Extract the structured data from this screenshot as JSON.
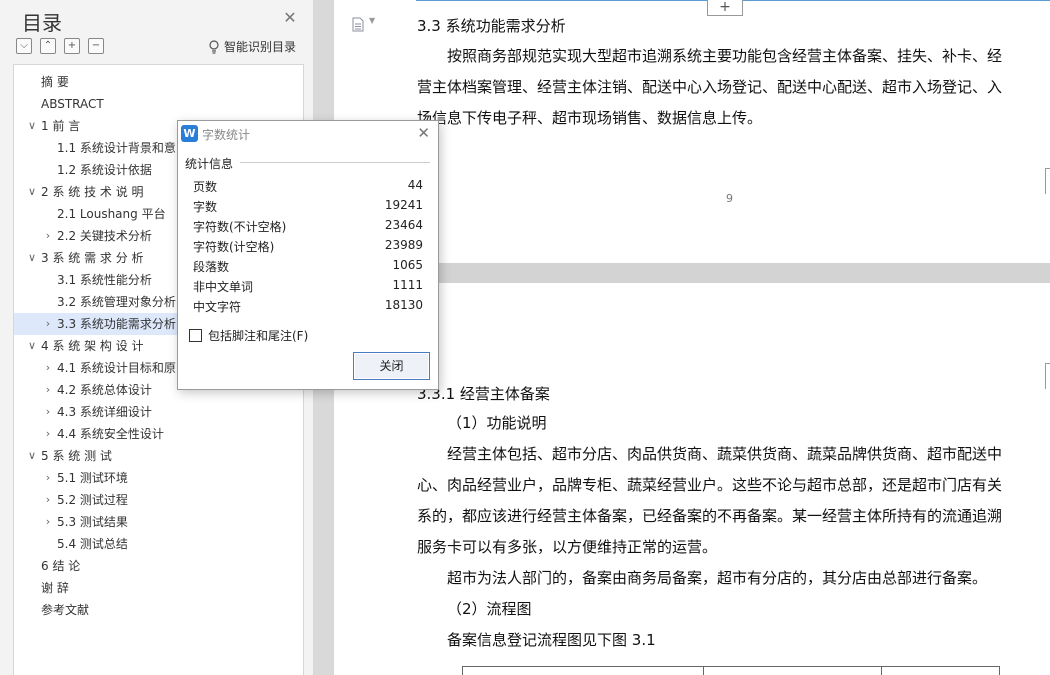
{
  "sidebar": {
    "title": "目录",
    "smart_toc_label": "智能识别目录",
    "tools": [
      "⌵",
      "⌃",
      "+",
      "−"
    ],
    "items": [
      {
        "label": "摘 要",
        "level": 1,
        "expandable": false
      },
      {
        "label": "ABSTRACT",
        "level": 1,
        "expandable": false
      },
      {
        "label": "1 前 言",
        "level": 1,
        "expandable": true
      },
      {
        "label": "1.1 系统设计背景和意",
        "level": 2,
        "expandable": false
      },
      {
        "label": "1.2 系统设计依据",
        "level": 2,
        "expandable": false
      },
      {
        "label": "2 系 统 技 术 说 明",
        "level": 1,
        "expandable": true
      },
      {
        "label": "2.1 Loushang 平台",
        "level": 2,
        "expandable": false
      },
      {
        "label": "2.2 关键技术分析",
        "level": 2,
        "expandable": true
      },
      {
        "label": "3 系 统 需 求 分 析",
        "level": 1,
        "expandable": true
      },
      {
        "label": "3.1 系统性能分析",
        "level": 2,
        "expandable": false
      },
      {
        "label": "3.2 系统管理对象分析",
        "level": 2,
        "expandable": false
      },
      {
        "label": "3.3 系统功能需求分析",
        "level": 2,
        "expandable": true,
        "active": true
      },
      {
        "label": "4 系 统 架 构 设 计",
        "level": 1,
        "expandable": true
      },
      {
        "label": "4.1 系统设计目标和原",
        "level": 2,
        "expandable": true
      },
      {
        "label": "4.2 系统总体设计",
        "level": 2,
        "expandable": true
      },
      {
        "label": "4.3 系统详细设计",
        "level": 2,
        "expandable": true
      },
      {
        "label": "4.4 系统安全性设计",
        "level": 2,
        "expandable": true
      },
      {
        "label": "5 系 统 测 试",
        "level": 1,
        "expandable": true
      },
      {
        "label": "5.1 测试环境",
        "level": 2,
        "expandable": true
      },
      {
        "label": "5.2 测试过程",
        "level": 2,
        "expandable": true
      },
      {
        "label": "5.3 测试结果",
        "level": 2,
        "expandable": true
      },
      {
        "label": "5.4 测试总结",
        "level": 2,
        "expandable": false
      },
      {
        "label": "6 结 论",
        "level": 1,
        "expandable": false
      },
      {
        "label": "谢 辞",
        "level": 1,
        "expandable": false
      },
      {
        "label": "参考文献",
        "level": 1,
        "expandable": false
      }
    ]
  },
  "dialog": {
    "logo": "W",
    "title": "字数统计",
    "section_label": "统计信息",
    "stats": [
      {
        "label": "页数",
        "value": "44"
      },
      {
        "label": "字数",
        "value": "19241"
      },
      {
        "label": "字符数(不计空格)",
        "value": "23464"
      },
      {
        "label": "字符数(计空格)",
        "value": "23989"
      },
      {
        "label": "段落数",
        "value": "1065"
      },
      {
        "label": "非中文单词",
        "value": "1111"
      },
      {
        "label": "中文字符",
        "value": "18130"
      }
    ],
    "checkbox_label": "包括脚注和尾注(F)",
    "checkbox_checked": false,
    "close_button": "关闭"
  },
  "document": {
    "page1": {
      "heading": "3.3  系统功能需求分析",
      "paragraph_lines": [
        "按照商务部规范实现大型超市追溯系统主要功能包含经营主体备案、挂失、补卡、经",
        "营主体档案管理、经营主体注销、配送中心入场登记、配送中心配送、超市入场登记、入",
        "场信息下传电子秤、超市现场销售、数据信息上传。"
      ],
      "page_number": "9"
    },
    "page2": {
      "heading": "3.3.1  经营主体备案",
      "lines": [
        {
          "text": "（1）功能说明",
          "indent": true
        },
        {
          "text": "经营主体包括、超市分店、肉品供货商、蔬菜供货商、蔬菜品牌供货商、超市配送中",
          "indent": true
        },
        {
          "text": "心、肉品经营业户，品牌专柜、蔬菜经营业户。这些不论与超市总部，还是超市门店有关",
          "indent": false
        },
        {
          "text": "系的，都应该进行经营主体备案，已经备案的不再备案。某一经营主体所持有的流通追溯",
          "indent": false
        },
        {
          "text": "服务卡可以有多张，以方便维持正常的运营。",
          "indent": false
        },
        {
          "text": "超市为法人部门的，备案由商务局备案，超市有分店的，其分店由总部进行备案。",
          "indent": true
        },
        {
          "text": "（2）流程图",
          "indent": true
        },
        {
          "text": "备案信息登记流程图见下图 3.1",
          "indent": true
        }
      ]
    },
    "add_button": "+"
  },
  "colors": {
    "sidebar_bg": "#f3f3f3",
    "active_item": "#dde9fb",
    "accent": "#2b7ed8",
    "workspace_bg": "#d9d9d9"
  }
}
